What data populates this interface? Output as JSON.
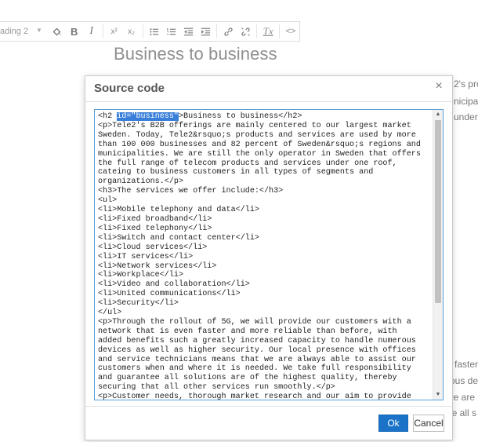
{
  "toolbar": {
    "block_format": "ading 2",
    "bold_label": "B",
    "italic_label": "I",
    "superscript_label": "x²",
    "subscript_label": "x₂",
    "clear_format_label": "Tx",
    "source_label": "<>"
  },
  "document": {
    "title": "Business to business",
    "right_snippets": [
      "2's pro",
      "nicipal",
      "under",
      "n faster",
      "rous de",
      "we are",
      "ee all s"
    ]
  },
  "dialog": {
    "title": "Source code",
    "close_label": "×",
    "ok_label": "Ok",
    "cancel_label": "Cancel",
    "code": {
      "line1_prefix": "<h2 ",
      "line1_selected": "id=\"business\"",
      "line1_suffix": ">Business to business</h2>",
      "rest": "<p>Tele2's B2B offerings are mainly centered to our largest market\nSweden. Today, Tele2&rsquo;s products and services are used by more\nthan 100 000 businesses and 82 percent of Sweden&rsquo;s regions and\nmunicipalities. We are still the only operator in Sweden that offers\nthe full range of telecom products and services under one roof,\ncateing to business customers in all types of segments and\norganizations.</p>\n<h3>The services we offer include:</h3>\n<ul>\n<li>Mobile telephony and data</li>\n<li>Fixed broadband</li>\n<li>Fixed telephony</li>\n<li>Switch and contact center</li>\n<li>Cloud services</li>\n<li>IT services</li>\n<li>Network services</li>\n<li>Workplace</li>\n<li>Video and collaboration</li>\n<li>United communications</li>\n<li>Security</li>\n</ul>\n<p>Through the rollout of 5G, we will provide our customers with a\nnetwork that is even faster and more reliable than before, with\nadded benefits such a greatly increased capacity to handle numerous\ndevices as well as higher security. Our local presence with offices\nand service technicians means that we are always able to assist our\ncustomers when and where it is needed. We take full responsibility\nand guarantee all solutions are of the highest quality, thereby\nsecuring that all other services run smoothly.</p>\n<p>Customer needs, thorough market research and our aim to provide"
    }
  }
}
